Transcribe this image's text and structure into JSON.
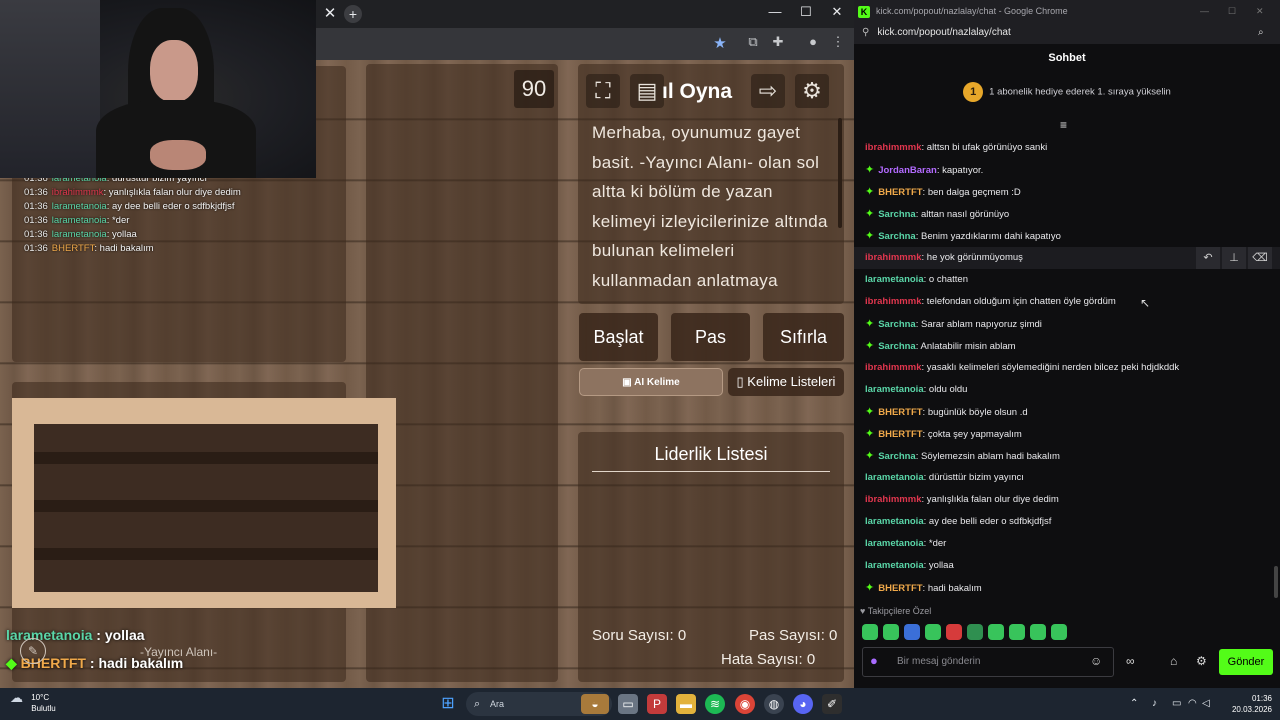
{
  "game": {
    "timer": "90",
    "howto_title": "ıl Oyna",
    "howto_text": "Merhaba, oyunumuz gayet basit. -Yayıncı Alanı- olan sol altta ki bölüm de yazan kelimeyi izleyicilerinize altında bulunan kelimeleri kullanmadan anlatmaya",
    "buttons": {
      "start": "Başlat",
      "pass": "Pas",
      "reset": "Sıfırla",
      "ai_word": "AI Kelime",
      "word_lists": "Kelime Listeleri"
    },
    "leaderboard_title": "Liderlik Listesi",
    "stats": {
      "questions": "Soru Sayısı: 0",
      "passes": "Pas Sayısı: 0",
      "errors": "Hata Sayısı: 0"
    },
    "streamer_area_label": "-Yayıncı Alanı-",
    "overlay_chat": [
      {
        "time": "01:36",
        "user": "larametanoia",
        "color": "#5ad6a8",
        "text": "dürüsttür bizim yayıncı"
      },
      {
        "time": "01:36",
        "user": "ibrahimmmk",
        "color": "#e0364e",
        "text": "yanlışlıkla falan olur diye dedim"
      },
      {
        "time": "01:36",
        "user": "larametanoia",
        "color": "#5ad6a8",
        "text": "ay dee belli eder o sdfbkjdfjsf"
      },
      {
        "time": "01:36",
        "user": "larametanoia",
        "color": "#5ad6a8",
        "text": "*der"
      },
      {
        "time": "01:36",
        "user": "larametanoia",
        "color": "#5ad6a8",
        "text": "yollaa"
      },
      {
        "time": "01:36",
        "user": "BHERTFT",
        "color": "#f0a94a",
        "text": "hadi bakalım"
      }
    ],
    "big_chat": [
      {
        "user": "larametanoia",
        "color": "#5ad6a8",
        "text": "yollaa"
      },
      {
        "user": "BHERTFT",
        "color": "#f0a94a",
        "text": "hadi bakalım"
      }
    ]
  },
  "chat_window": {
    "title": "kick.com/popout/nazlalay/chat - Google Chrome",
    "address": "kick.com/popout/nazlalay/chat",
    "header": "Sohbet",
    "promo_rank": "1",
    "promo_text": "1 abonelik hediye ederek 1. sıraya yükselin",
    "messages": [
      {
        "user": "ibrahimmmk",
        "color": "#e0364e",
        "badge": false,
        "text": "alttsn bi ufak görünüyo sanki"
      },
      {
        "user": "JordanBaran",
        "color": "#b36bff",
        "badge": true,
        "text": "kapatıyor."
      },
      {
        "user": "BHERTFT",
        "color": "#f0a94a",
        "badge": true,
        "text": "ben dalga geçmem :D"
      },
      {
        "user": "Sarchna",
        "color": "#5ad6a8",
        "badge": true,
        "text": "alttan nasıl görünüyo"
      },
      {
        "user": "Sarchna",
        "color": "#5ad6a8",
        "badge": true,
        "text": "Benim yazdıklarımı dahi kapatıyo"
      },
      {
        "user": "ibrahimmmk",
        "color": "#e0364e",
        "badge": false,
        "text": "he yok görünmüyomuş",
        "highlight": true
      },
      {
        "user": "larametanoia",
        "color": "#5ad6a8",
        "badge": false,
        "text": "o chatten"
      },
      {
        "user": "ibrahimmmk",
        "color": "#e0364e",
        "badge": false,
        "text": "telefondan olduğum için chatten öyle gördüm"
      },
      {
        "user": "Sarchna",
        "color": "#5ad6a8",
        "badge": true,
        "text": "Sarar ablam napıyoruz şimdi"
      },
      {
        "user": "Sarchna",
        "color": "#5ad6a8",
        "badge": true,
        "text": "Anlatabilir misin ablam"
      },
      {
        "user": "ibrahimmmk",
        "color": "#e0364e",
        "badge": false,
        "text": "yasaklı kelimeleri söylemediğini nerden bilcez peki hdjdkddk"
      },
      {
        "user": "larametanoia",
        "color": "#5ad6a8",
        "badge": false,
        "text": "oldu oldu"
      },
      {
        "user": "BHERTFT",
        "color": "#f0a94a",
        "badge": true,
        "text": "bugünlük böyle olsun .d"
      },
      {
        "user": "BHERTFT",
        "color": "#f0a94a",
        "badge": true,
        "text": "çokta şey yapmayalım"
      },
      {
        "user": "Sarchna",
        "color": "#5ad6a8",
        "badge": true,
        "text": "Söylemezsin ablam hadi bakalım"
      },
      {
        "user": "larametanoia",
        "color": "#5ad6a8",
        "badge": false,
        "text": "dürüsttür bizim yayıncı"
      },
      {
        "user": "ibrahimmmk",
        "color": "#e0364e",
        "badge": false,
        "text": "yanlışlıkla falan olur diye dedim"
      },
      {
        "user": "larametanoia",
        "color": "#5ad6a8",
        "badge": false,
        "text": "ay dee belli eder o sdfbkjdfjsf"
      },
      {
        "user": "larametanoia",
        "color": "#5ad6a8",
        "badge": false,
        "text": "*der"
      },
      {
        "user": "larametanoia",
        "color": "#5ad6a8",
        "badge": false,
        "text": "yollaa"
      },
      {
        "user": "BHERTFT",
        "color": "#f0a94a",
        "badge": true,
        "text": "hadi bakalım"
      }
    ],
    "emote_section_label": "Takipçilere Özel",
    "input_placeholder": "Bir mesaj gönderin",
    "send_label": "Gönder"
  },
  "taskbar": {
    "weather_temp": "10°C",
    "weather_desc": "Bulutlu",
    "search_placeholder": "Ara",
    "time": "01:36",
    "date": "20.03.2026"
  },
  "colors": {
    "kick_green": "#53fc18",
    "chat_bg": "#0e0e10",
    "taskbar_bg": "#1d2530"
  }
}
